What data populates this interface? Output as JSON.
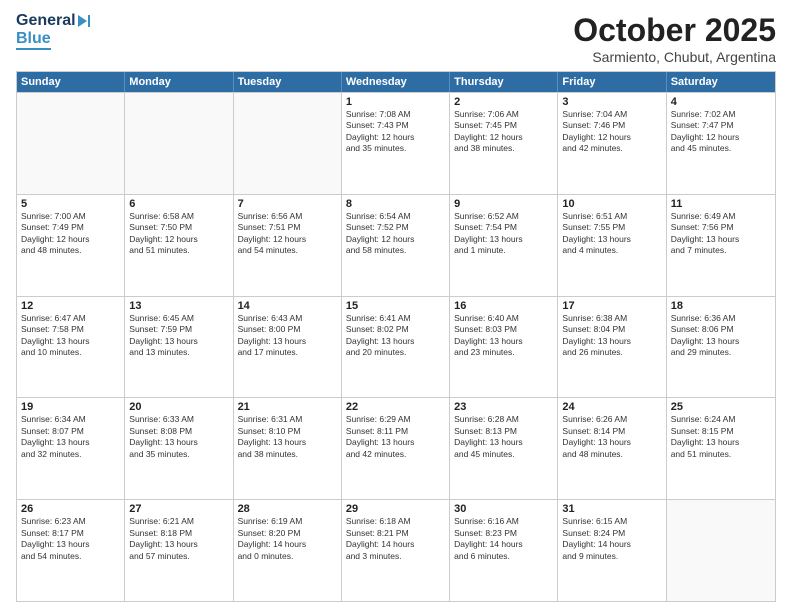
{
  "header": {
    "logo_general": "General",
    "logo_blue": "Blue",
    "month_title": "October 2025",
    "subtitle": "Sarmiento, Chubut, Argentina"
  },
  "weekdays": [
    "Sunday",
    "Monday",
    "Tuesday",
    "Wednesday",
    "Thursday",
    "Friday",
    "Saturday"
  ],
  "rows": [
    [
      {
        "day": "",
        "lines": []
      },
      {
        "day": "",
        "lines": []
      },
      {
        "day": "",
        "lines": []
      },
      {
        "day": "1",
        "lines": [
          "Sunrise: 7:08 AM",
          "Sunset: 7:43 PM",
          "Daylight: 12 hours",
          "and 35 minutes."
        ]
      },
      {
        "day": "2",
        "lines": [
          "Sunrise: 7:06 AM",
          "Sunset: 7:45 PM",
          "Daylight: 12 hours",
          "and 38 minutes."
        ]
      },
      {
        "day": "3",
        "lines": [
          "Sunrise: 7:04 AM",
          "Sunset: 7:46 PM",
          "Daylight: 12 hours",
          "and 42 minutes."
        ]
      },
      {
        "day": "4",
        "lines": [
          "Sunrise: 7:02 AM",
          "Sunset: 7:47 PM",
          "Daylight: 12 hours",
          "and 45 minutes."
        ]
      }
    ],
    [
      {
        "day": "5",
        "lines": [
          "Sunrise: 7:00 AM",
          "Sunset: 7:49 PM",
          "Daylight: 12 hours",
          "and 48 minutes."
        ]
      },
      {
        "day": "6",
        "lines": [
          "Sunrise: 6:58 AM",
          "Sunset: 7:50 PM",
          "Daylight: 12 hours",
          "and 51 minutes."
        ]
      },
      {
        "day": "7",
        "lines": [
          "Sunrise: 6:56 AM",
          "Sunset: 7:51 PM",
          "Daylight: 12 hours",
          "and 54 minutes."
        ]
      },
      {
        "day": "8",
        "lines": [
          "Sunrise: 6:54 AM",
          "Sunset: 7:52 PM",
          "Daylight: 12 hours",
          "and 58 minutes."
        ]
      },
      {
        "day": "9",
        "lines": [
          "Sunrise: 6:52 AM",
          "Sunset: 7:54 PM",
          "Daylight: 13 hours",
          "and 1 minute."
        ]
      },
      {
        "day": "10",
        "lines": [
          "Sunrise: 6:51 AM",
          "Sunset: 7:55 PM",
          "Daylight: 13 hours",
          "and 4 minutes."
        ]
      },
      {
        "day": "11",
        "lines": [
          "Sunrise: 6:49 AM",
          "Sunset: 7:56 PM",
          "Daylight: 13 hours",
          "and 7 minutes."
        ]
      }
    ],
    [
      {
        "day": "12",
        "lines": [
          "Sunrise: 6:47 AM",
          "Sunset: 7:58 PM",
          "Daylight: 13 hours",
          "and 10 minutes."
        ]
      },
      {
        "day": "13",
        "lines": [
          "Sunrise: 6:45 AM",
          "Sunset: 7:59 PM",
          "Daylight: 13 hours",
          "and 13 minutes."
        ]
      },
      {
        "day": "14",
        "lines": [
          "Sunrise: 6:43 AM",
          "Sunset: 8:00 PM",
          "Daylight: 13 hours",
          "and 17 minutes."
        ]
      },
      {
        "day": "15",
        "lines": [
          "Sunrise: 6:41 AM",
          "Sunset: 8:02 PM",
          "Daylight: 13 hours",
          "and 20 minutes."
        ]
      },
      {
        "day": "16",
        "lines": [
          "Sunrise: 6:40 AM",
          "Sunset: 8:03 PM",
          "Daylight: 13 hours",
          "and 23 minutes."
        ]
      },
      {
        "day": "17",
        "lines": [
          "Sunrise: 6:38 AM",
          "Sunset: 8:04 PM",
          "Daylight: 13 hours",
          "and 26 minutes."
        ]
      },
      {
        "day": "18",
        "lines": [
          "Sunrise: 6:36 AM",
          "Sunset: 8:06 PM",
          "Daylight: 13 hours",
          "and 29 minutes."
        ]
      }
    ],
    [
      {
        "day": "19",
        "lines": [
          "Sunrise: 6:34 AM",
          "Sunset: 8:07 PM",
          "Daylight: 13 hours",
          "and 32 minutes."
        ]
      },
      {
        "day": "20",
        "lines": [
          "Sunrise: 6:33 AM",
          "Sunset: 8:08 PM",
          "Daylight: 13 hours",
          "and 35 minutes."
        ]
      },
      {
        "day": "21",
        "lines": [
          "Sunrise: 6:31 AM",
          "Sunset: 8:10 PM",
          "Daylight: 13 hours",
          "and 38 minutes."
        ]
      },
      {
        "day": "22",
        "lines": [
          "Sunrise: 6:29 AM",
          "Sunset: 8:11 PM",
          "Daylight: 13 hours",
          "and 42 minutes."
        ]
      },
      {
        "day": "23",
        "lines": [
          "Sunrise: 6:28 AM",
          "Sunset: 8:13 PM",
          "Daylight: 13 hours",
          "and 45 minutes."
        ]
      },
      {
        "day": "24",
        "lines": [
          "Sunrise: 6:26 AM",
          "Sunset: 8:14 PM",
          "Daylight: 13 hours",
          "and 48 minutes."
        ]
      },
      {
        "day": "25",
        "lines": [
          "Sunrise: 6:24 AM",
          "Sunset: 8:15 PM",
          "Daylight: 13 hours",
          "and 51 minutes."
        ]
      }
    ],
    [
      {
        "day": "26",
        "lines": [
          "Sunrise: 6:23 AM",
          "Sunset: 8:17 PM",
          "Daylight: 13 hours",
          "and 54 minutes."
        ]
      },
      {
        "day": "27",
        "lines": [
          "Sunrise: 6:21 AM",
          "Sunset: 8:18 PM",
          "Daylight: 13 hours",
          "and 57 minutes."
        ]
      },
      {
        "day": "28",
        "lines": [
          "Sunrise: 6:19 AM",
          "Sunset: 8:20 PM",
          "Daylight: 14 hours",
          "and 0 minutes."
        ]
      },
      {
        "day": "29",
        "lines": [
          "Sunrise: 6:18 AM",
          "Sunset: 8:21 PM",
          "Daylight: 14 hours",
          "and 3 minutes."
        ]
      },
      {
        "day": "30",
        "lines": [
          "Sunrise: 6:16 AM",
          "Sunset: 8:23 PM",
          "Daylight: 14 hours",
          "and 6 minutes."
        ]
      },
      {
        "day": "31",
        "lines": [
          "Sunrise: 6:15 AM",
          "Sunset: 8:24 PM",
          "Daylight: 14 hours",
          "and 9 minutes."
        ]
      },
      {
        "day": "",
        "lines": []
      }
    ]
  ]
}
